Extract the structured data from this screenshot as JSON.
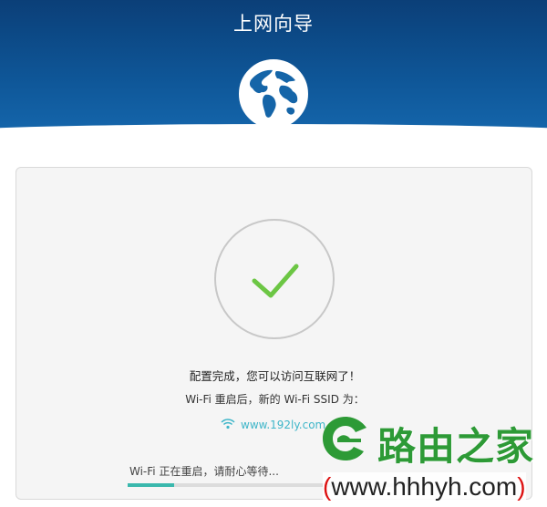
{
  "header": {
    "title": "上网向导",
    "icon": "globe-icon"
  },
  "status": {
    "icon": "check-icon",
    "accent_color": "#6cc644",
    "message": "配置完成，您可以访问互联网了！",
    "ssid_label": "Wi-Fi 重启后，新的 Wi-Fi SSID 为：",
    "ssid_value": "www.192ly.com",
    "restart_text": "Wi-Fi 正在重启，请耐心等待...",
    "progress_percent": 16
  },
  "watermark": {
    "name": "路由之家",
    "url": "www.hhhyh.com",
    "color": "#2d9a36"
  }
}
